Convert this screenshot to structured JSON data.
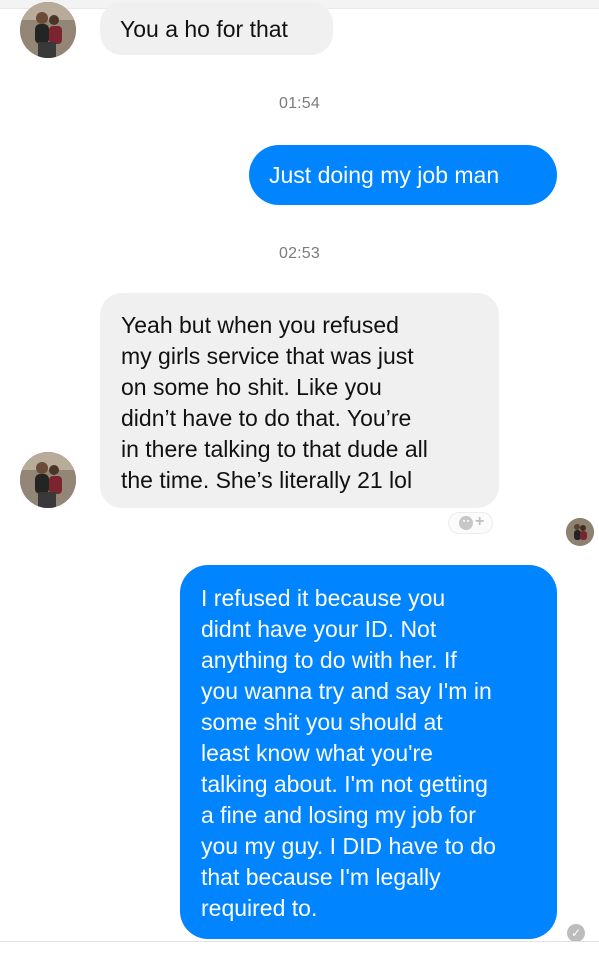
{
  "conversation": {
    "messages": [
      {
        "direction": "incoming",
        "text": "You a ho for that"
      },
      {
        "direction": "outgoing",
        "timestamp": "01:54",
        "text": "Just doing my job man"
      },
      {
        "direction": "incoming",
        "timestamp": "02:53",
        "text": "Yeah but when you refused\nmy girls service that was just\non some ho shit. Like you\ndidn’t have to do that. You’re\nin there talking to that dude all\nthe time. She’s literally 21 lol"
      },
      {
        "direction": "outgoing",
        "text": "I refused it because you\ndidnt have your ID. Not\nanything to do with her. If\nyou wanna try and say I'm in\nsome shit you should at\nleast know what you're\ntalking about. I'm not getting\na fine and losing my job for\nyou my guy. I DID have to do\nthat because I'm legally\nrequired to."
      }
    ]
  },
  "ui": {
    "reaction_icon": "add-reaction-icon",
    "seen_icon": "seen-check-icon",
    "avatar_icon": "user-avatar",
    "colors": {
      "incoming_bubble": "#f1f0f0",
      "outgoing_bubble": "#0084ff",
      "timestamp": "#7b7b7b"
    }
  }
}
